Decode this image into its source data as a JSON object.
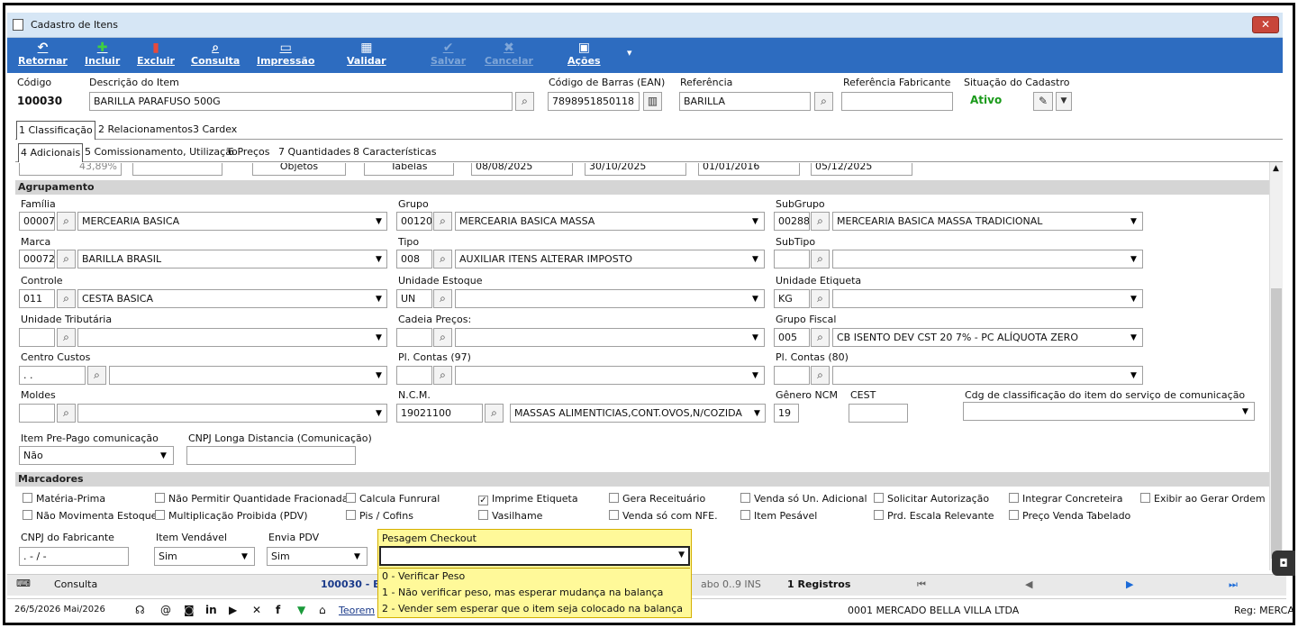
{
  "window": {
    "title": "Cadastro de Itens",
    "close": "✕"
  },
  "toolbar": [
    {
      "label": "Retornar",
      "icon": "undo-icon",
      "glyph": "↶"
    },
    {
      "label": "Incluir",
      "icon": "plus-icon",
      "glyph": "✚"
    },
    {
      "label": "Excluir",
      "icon": "trash-icon",
      "glyph": "▮"
    },
    {
      "label": "Consulta",
      "icon": "search-icon",
      "glyph": "⌕"
    },
    {
      "label": "Impressão",
      "icon": "printer-icon",
      "glyph": "▭"
    },
    {
      "label": "Validar",
      "icon": "grid-icon",
      "glyph": "▦"
    },
    {
      "label": "Salvar",
      "icon": "check-icon",
      "glyph": "✔",
      "disabled": true
    },
    {
      "label": "Cancelar",
      "icon": "x-icon",
      "glyph": "✖",
      "disabled": true
    },
    {
      "label": "Ações",
      "icon": "actions-icon",
      "glyph": "▣"
    }
  ],
  "header": {
    "codigo_label": "Código",
    "codigo": "100030",
    "descricao_label": "Descrição do Item",
    "descricao": "BARILLA PARAFUSO 500G",
    "ean_label": "Código de Barras (EAN)",
    "ean": "7898951850118",
    "referencia_label": "Referência",
    "referencia": "BARILLA",
    "ref_fab_label": "Referência Fabricante",
    "ref_fab": "",
    "situacao_label": "Situação do Cadastro",
    "situacao": "Ativo"
  },
  "tabs1": [
    "1 Classificação",
    "2 Relacionamentos",
    "3 Cardex"
  ],
  "tabs2": [
    "4 Adicionais",
    "5 Comissionamento, Utilização",
    "6 Preços",
    "7 Quantidades",
    "8 Características"
  ],
  "partial_row": {
    "pct": "43,89%",
    "btn1": "Objetos",
    "btn2": "Tabelas",
    "d1": "08/08/2025",
    "d2": "30/10/2025",
    "d3": "01/01/2016",
    "d4": "05/12/2025"
  },
  "agrupamento": {
    "title": "Agrupamento",
    "familia": {
      "label": "Família",
      "code": "00007",
      "value": "MERCEARIA BASICA"
    },
    "grupo": {
      "label": "Grupo",
      "code": "00120",
      "value": "MERCEARIA BASICA MASSA"
    },
    "subgrupo": {
      "label": "SubGrupo",
      "code": "00288",
      "value": "MERCEARIA BASICA MASSA TRADICIONAL"
    },
    "marca": {
      "label": "Marca",
      "code": "00072",
      "value": "BARILLA BRASIL"
    },
    "tipo": {
      "label": "Tipo",
      "code": "008",
      "value": "AUXILIAR ITENS ALTERAR IMPOSTO"
    },
    "subtipo": {
      "label": "SubTipo",
      "code": "",
      "value": ""
    },
    "controle": {
      "label": "Controle",
      "code": "011",
      "value": "CESTA BASICA"
    },
    "unid_estoque": {
      "label": "Unidade Estoque",
      "code": "UN",
      "value": ""
    },
    "unid_etiqueta": {
      "label": "Unidade Etiqueta",
      "code": "KG",
      "value": ""
    },
    "unid_trib": {
      "label": "Unidade Tributária",
      "code": "",
      "value": ""
    },
    "cadeia": {
      "label": "Cadeia Preços:",
      "code": "",
      "value": ""
    },
    "grupo_fiscal": {
      "label": "Grupo Fiscal",
      "code": "005",
      "value": "CB ISENTO DEV CST 20 7% - PC ALÍQUOTA ZERO"
    },
    "centro_custos": {
      "label": "Centro Custos",
      "code": " .  .",
      "value": ""
    },
    "pl_contas97": {
      "label": "Pl. Contas (97)",
      "code": "",
      "value": ""
    },
    "pl_contas80": {
      "label": "Pl. Contas (80)",
      "code": "",
      "value": ""
    },
    "moldes": {
      "label": "Moldes",
      "code": "",
      "value": ""
    },
    "ncm": {
      "label": "N.C.M.",
      "code": "19021100",
      "value": "MASSAS ALIMENTICIAS,CONT.OVOS,N/COZIDA"
    },
    "genero_ncm": {
      "label": "Gênero NCM",
      "value": "19"
    },
    "cest": {
      "label": "CEST",
      "value": ""
    },
    "cdg_class": {
      "label": "Cdg de classificação do item do serviço de comunicação",
      "value": ""
    },
    "pre_pago": {
      "label": "Item Pre-Pago comunicação",
      "value": "Não"
    },
    "cnpj_longa": {
      "label": "CNPJ Longa Distancia (Comunicação)",
      "value": ""
    }
  },
  "marcadores": {
    "title": "Marcadores",
    "items": [
      {
        "label": "Matéria-Prima",
        "checked": false
      },
      {
        "label": "Não Permitir Quantidade Fracionada",
        "checked": false
      },
      {
        "label": "Calcula Funrural",
        "checked": false
      },
      {
        "label": "Imprime Etiqueta",
        "checked": true
      },
      {
        "label": "Gera Receituário",
        "checked": false
      },
      {
        "label": "Venda só Un. Adicional",
        "checked": false
      },
      {
        "label": "Solicitar Autorização",
        "checked": false
      },
      {
        "label": "Integrar Concreteira",
        "checked": false
      },
      {
        "label": "Exibir ao Gerar Ordem",
        "checked": false
      },
      {
        "label": "Não Movimenta Estoque",
        "checked": false
      },
      {
        "label": "Multiplicação Proibida (PDV)",
        "checked": false
      },
      {
        "label": "Pis / Cofins",
        "checked": false
      },
      {
        "label": "Vasilhame",
        "checked": false
      },
      {
        "label": "Venda só com NFE.",
        "checked": false
      },
      {
        "label": "Item Pesável",
        "checked": false
      },
      {
        "label": "Prd. Escala Relevante",
        "checked": false
      },
      {
        "label": "Preço Venda Tabelado",
        "checked": false
      }
    ],
    "cnpj_fab": {
      "label": "CNPJ do Fabricante",
      "value": " . -  /   -"
    },
    "item_vendavel": {
      "label": "Item Vendável",
      "value": "Sim"
    },
    "envia_pdv": {
      "label": "Envia PDV",
      "value": "Sim"
    },
    "pesagem": {
      "label": "Pesagem Checkout",
      "options": [
        "0 - Verificar Peso",
        "1 - Não verificar peso, mas esperar mudança na balança",
        "2 - Vender sem esperar que o item seja colocado na balança"
      ]
    }
  },
  "status": {
    "consulta": "Consulta",
    "record": "100030 - B",
    "misc": "abo  0..9  INS",
    "registros": "1 Registros"
  },
  "footer": {
    "date": "26/5/2026 Mai/2026",
    "company": "0001 MERCADO BELLA VILLA LTDA",
    "reg": "Reg: MERCA",
    "teorema": "Teorem"
  }
}
